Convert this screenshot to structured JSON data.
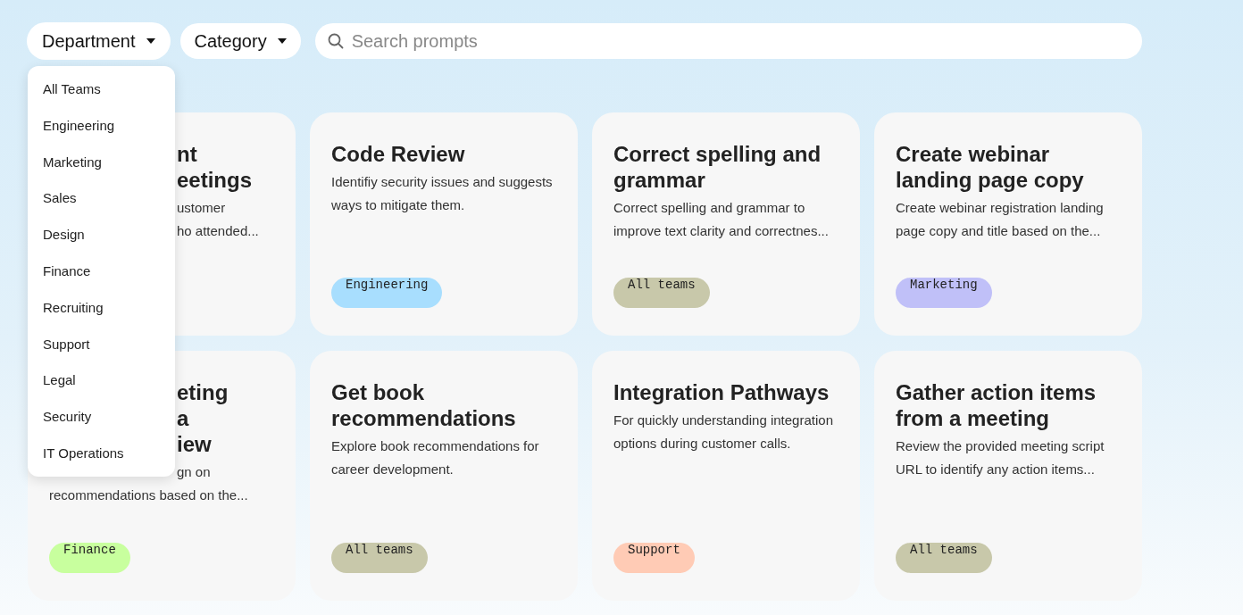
{
  "filters": [
    {
      "label": "Department",
      "expanded": true
    },
    {
      "label": "Category",
      "expanded": false
    }
  ],
  "search": {
    "placeholder": "Search prompts"
  },
  "department_menu": [
    "All Teams",
    "Engineering",
    "Marketing",
    "Sales",
    "Design",
    "Finance",
    "Recruiting",
    "Support",
    "Legal",
    "Security",
    "IT Operations"
  ],
  "cards": [
    {
      "title_lines": [
        {
          "text": "nt",
          "covered": true
        },
        {
          "text": "eetings",
          "covered": true
        }
      ],
      "description_lines": [
        {
          "text": "ustomer",
          "covered": true
        },
        {
          "text": "ho attended...",
          "covered": true
        }
      ]
    },
    {
      "title": "Code Review",
      "description": "Identifiy security issues and suggests ways to mitigate them.",
      "tag": {
        "label": "Engineering",
        "color": "#a8defe"
      }
    },
    {
      "title": "Correct spelling and grammar",
      "description": "Correct spelling and grammar to improve text clarity and correctnes...",
      "tag": {
        "label": "All teams",
        "color": "#c8c8aa"
      }
    },
    {
      "title": "Create webinar landing page copy",
      "description": "Create webinar registration landing page copy and title based on the...",
      "tag": {
        "label": "Marketing",
        "color": "#c0c0f8"
      }
    },
    {
      "title_lines": [
        {
          "text": "eting",
          "covered": true
        },
        {
          "text": "a",
          "covered": true
        },
        {
          "text": "iew",
          "covered": true
        }
      ],
      "description_lines": [
        {
          "text": "gn on",
          "covered": true
        },
        {
          "text": "recommendations based on the...",
          "covered": false
        }
      ],
      "tag": {
        "label": "Finance",
        "color": "#c8ff9e"
      }
    },
    {
      "title": "Get book recommendations",
      "description": "Explore book recommendations for career development.",
      "tag": {
        "label": "All teams",
        "color": "#c8c8aa"
      }
    },
    {
      "title": "Integration Pathways",
      "description": "For quickly understanding integration options during customer calls.",
      "tag": {
        "label": "Support",
        "color": "#ffcbb5"
      }
    },
    {
      "title": "Gather action items from a meeting",
      "description": "Review the provided meeting script URL to identify any action items...",
      "tag": {
        "label": "All teams",
        "color": "#c8c8aa"
      }
    }
  ]
}
